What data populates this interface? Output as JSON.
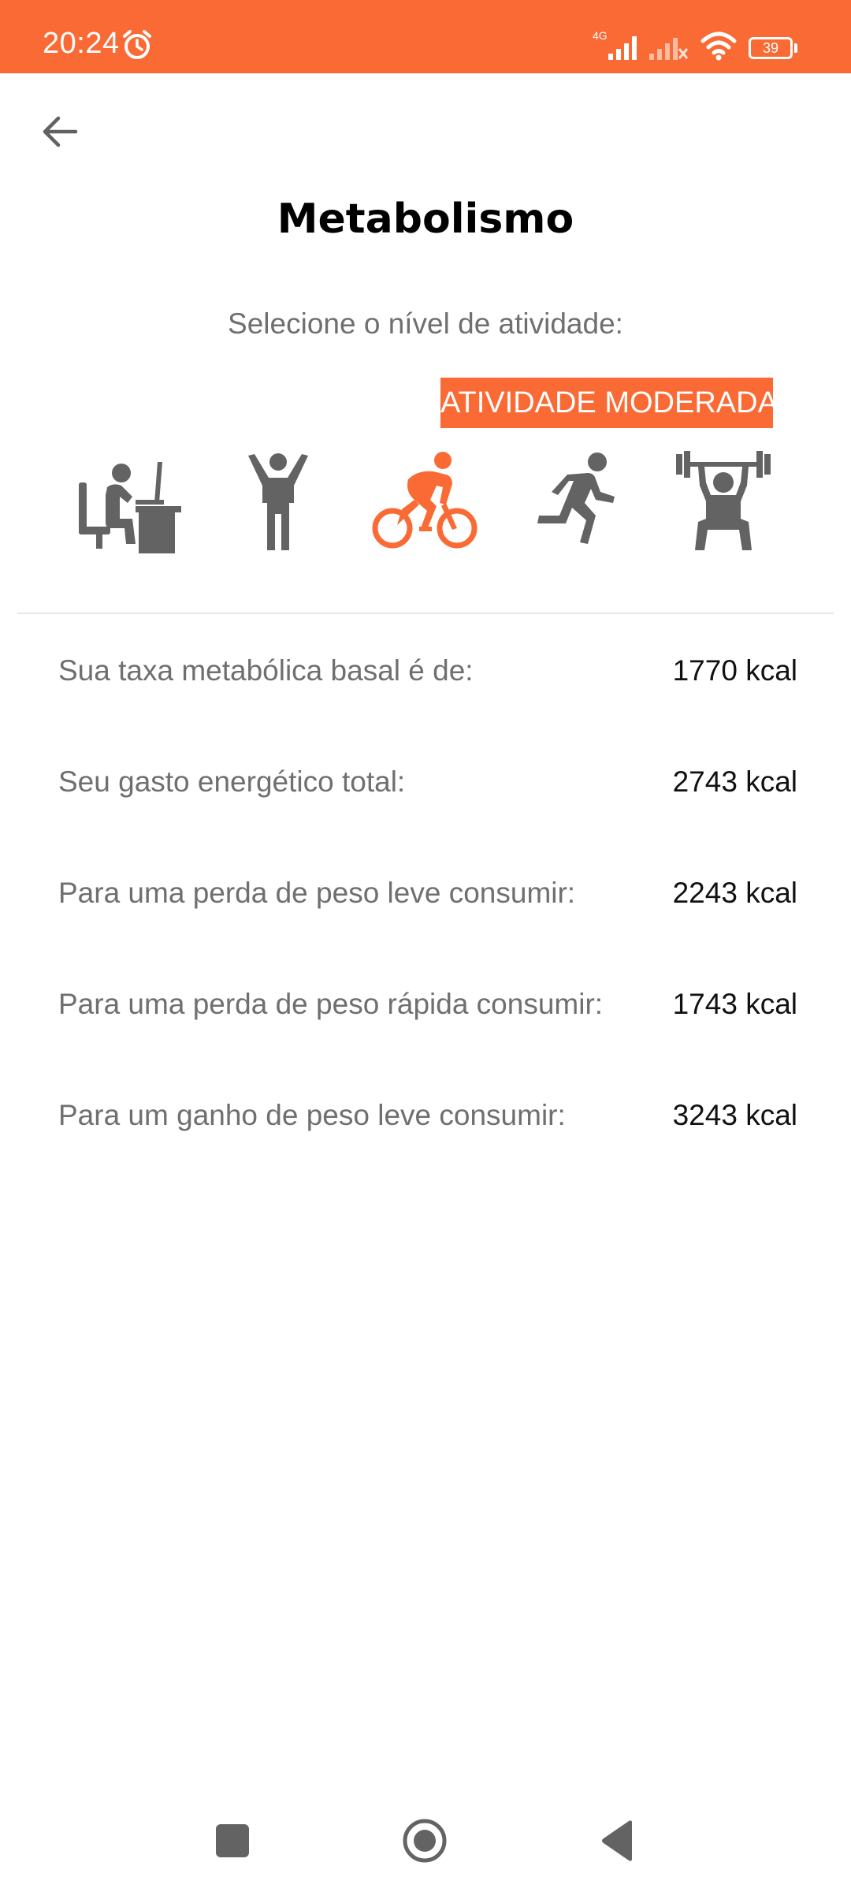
{
  "status_bar": {
    "time": "20:24",
    "battery_level": "39",
    "network_label": "4G",
    "background_color": "#F96A35"
  },
  "header": {
    "back_icon": "arrow-left-icon",
    "title": "Metabolismo"
  },
  "activity": {
    "prompt": "Selecione o nível de atividade:",
    "selected_label": "ATIVIDADE MODERADA",
    "accent_color": "#F96A35",
    "inactive_color": "#636363",
    "icons": [
      {
        "name": "sedentary-desk-icon",
        "selected": false
      },
      {
        "name": "standing-person-icon",
        "selected": false
      },
      {
        "name": "cyclist-icon",
        "selected": true
      },
      {
        "name": "runner-icon",
        "selected": false
      },
      {
        "name": "weightlifter-icon",
        "selected": false
      }
    ]
  },
  "results": [
    {
      "label": "Sua taxa metabólica basal é de:",
      "value": "1770 kcal"
    },
    {
      "label": "Seu gasto energético total:",
      "value": "2743 kcal"
    },
    {
      "label": "Para uma perda de peso leve consumir:",
      "value": "2243 kcal"
    },
    {
      "label": "Para uma perda de peso rápida consumir:",
      "value": "1743 kcal"
    },
    {
      "label": "Para um ganho de peso leve consumir:",
      "value": "3243 kcal"
    }
  ],
  "nav_bar": {
    "recents_icon": "square-icon",
    "home_icon": "circle-home-icon",
    "back_icon": "triangle-back-icon"
  }
}
